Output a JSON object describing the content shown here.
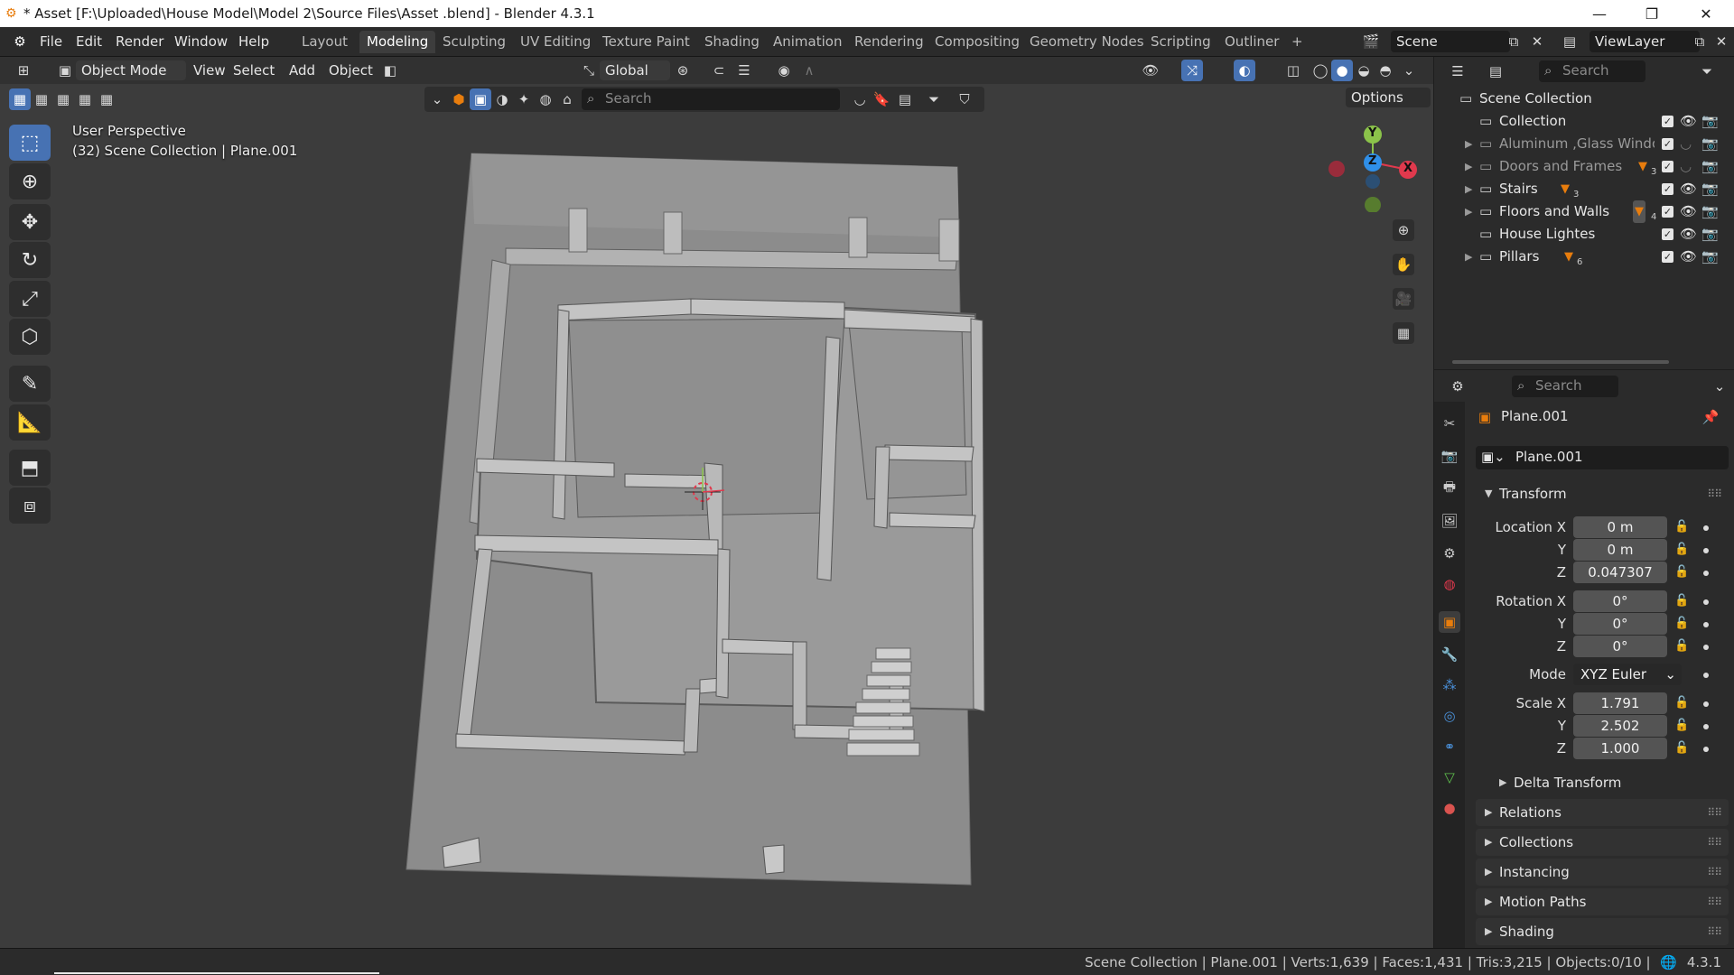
{
  "window": {
    "title": "* Asset  [F:\\Uploaded\\House Model\\Model 2\\Source Files\\Asset .blend] - Blender 4.3.1",
    "minimize_icon": "minimize-icon",
    "maximize_icon": "maximize-icon",
    "close_icon": "close-icon"
  },
  "menu": {
    "items": [
      "File",
      "Edit",
      "Render",
      "Window",
      "Help"
    ]
  },
  "workspaces": {
    "tabs": [
      "Layout",
      "Modeling",
      "Sculpting",
      "UV Editing",
      "Texture Paint",
      "Shading",
      "Animation",
      "Rendering",
      "Compositing",
      "Geometry Nodes",
      "Scripting",
      "Outliner"
    ],
    "active": "Modeling",
    "add_label": "+"
  },
  "scene": {
    "name": "Scene",
    "view_layer": "ViewLayer"
  },
  "viewport_header": {
    "mode": "Object Mode",
    "menus": [
      "View",
      "Select",
      "Add",
      "Object"
    ],
    "orientation": "Global",
    "search_placeholder": "Search",
    "options_label": "Options"
  },
  "viewport": {
    "perspective": "User Perspective",
    "collection_info": "(32) Scene Collection | Plane.001",
    "gizmo": {
      "x": "X",
      "y": "Y",
      "z": "Z"
    }
  },
  "outliner": {
    "search_placeholder": "Search",
    "root": "Scene Collection",
    "rows": [
      {
        "name": "Collection",
        "badge": "",
        "expandable": false,
        "disabled": false
      },
      {
        "name": "Aluminum ,Glass Window",
        "badge": "",
        "expandable": true,
        "disabled": true
      },
      {
        "name": "Doors and Frames",
        "badge": "3",
        "expandable": true,
        "disabled": true
      },
      {
        "name": "Stairs",
        "badge": "3",
        "expandable": true,
        "disabled": false
      },
      {
        "name": "Floors and Walls",
        "badge": "4",
        "expandable": true,
        "disabled": false
      },
      {
        "name": "House Lightes",
        "badge": "",
        "expandable": false,
        "disabled": false
      },
      {
        "name": "Pillars",
        "badge": "6",
        "expandable": true,
        "disabled": false
      }
    ]
  },
  "properties": {
    "search_placeholder": "Search",
    "object_name": "Plane.001",
    "datablock_name": "Plane.001",
    "transform_label": "Transform",
    "location": {
      "label": "Location X",
      "x": "0 m",
      "y": "0 m",
      "z": "0.047307"
    },
    "rotation": {
      "label": "Rotation X",
      "x": "0°",
      "y": "0°",
      "z": "0°"
    },
    "mode": {
      "label": "Mode",
      "value": "XYZ Euler"
    },
    "scale": {
      "label": "Scale X",
      "x": "1.791",
      "y": "2.502",
      "z": "1.000"
    },
    "axis_labels": {
      "y": "Y",
      "z": "Z"
    },
    "panels": [
      "Delta Transform",
      "Relations",
      "Collections",
      "Instancing",
      "Motion Paths",
      "Shading"
    ]
  },
  "statusbar": {
    "text": "Scene Collection | Plane.001 | Verts:1,639 | Faces:1,431 | Tris:3,215 | Objects:0/10 |",
    "version": "4.3.1"
  },
  "colors": {
    "accent": "#4772b3",
    "active_object": "#e87d0d",
    "gizmo_x": "#e0394d",
    "gizmo_y": "#8bc34a",
    "gizmo_z": "#2f8fe8"
  }
}
